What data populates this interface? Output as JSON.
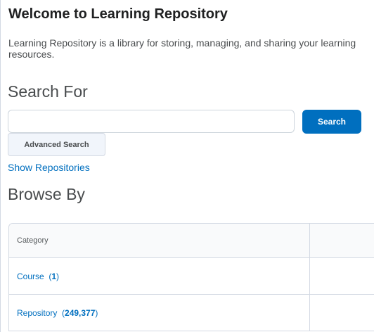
{
  "welcome": {
    "title": "Welcome to Learning Repository",
    "description": "Learning Repository is a library for storing, managing, and sharing your learning resources."
  },
  "search": {
    "heading": "Search For",
    "input_value": "",
    "placeholder": "",
    "search_label": "Search",
    "advanced_label": "Advanced Search",
    "show_repositories_label": "Show Repositories"
  },
  "browse": {
    "heading": "Browse By",
    "table": {
      "header": "Category",
      "rows": [
        {
          "label": "Course",
          "count": "1"
        },
        {
          "label": "Repository",
          "count": "249,377"
        }
      ]
    }
  },
  "colors": {
    "accent": "#006fbf",
    "text": "#494c4e",
    "border": "#d3d9e3"
  }
}
